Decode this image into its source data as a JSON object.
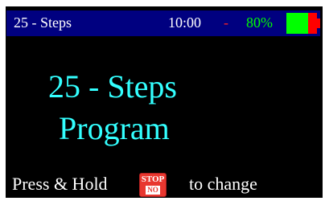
{
  "status": {
    "title": "25 - Steps",
    "time": "10:00",
    "separator": "-",
    "battery_percent_text": "80%",
    "battery_level": 0.8,
    "colors": {
      "bar_bg": "#000080",
      "title": "#ffffff",
      "separator": "#ff2222",
      "battery_text": "#00ff00",
      "battery_fill": "#00ff00",
      "battery_empty": "#ff0000"
    }
  },
  "main": {
    "program_name": "25 - Steps",
    "program_label": "Program",
    "color": "#33ffff"
  },
  "instruction": {
    "before": "Press & Hold",
    "button_top": "STOP",
    "button_bottom": "NO",
    "after": "to change",
    "button_icon": "stop-no-button-icon"
  }
}
